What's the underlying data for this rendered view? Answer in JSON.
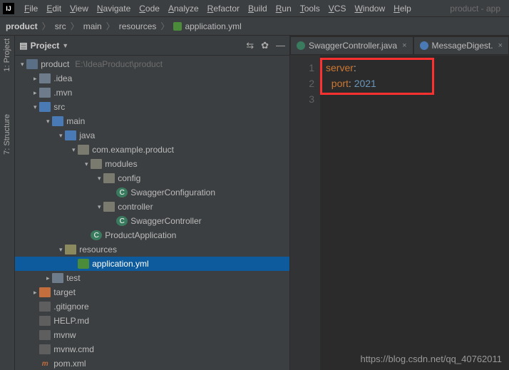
{
  "menu": {
    "items": [
      "File",
      "Edit",
      "View",
      "Navigate",
      "Code",
      "Analyze",
      "Refactor",
      "Build",
      "Run",
      "Tools",
      "VCS",
      "Window",
      "Help"
    ],
    "right": "product - app"
  },
  "breadcrumb": {
    "parts": [
      "product",
      "src",
      "main",
      "resources",
      "application.yml"
    ]
  },
  "gutter": {
    "project": "1: Project",
    "structure": "7: Structure"
  },
  "panel": {
    "title": "Project"
  },
  "tree": [
    {
      "d": 0,
      "c": "▾",
      "i": "module",
      "l": "product",
      "hint": "E:\\IdeaProduct\\product"
    },
    {
      "d": 1,
      "c": "▸",
      "i": "folder",
      "l": ".idea"
    },
    {
      "d": 1,
      "c": "▸",
      "i": "folder",
      "l": ".mvn"
    },
    {
      "d": 1,
      "c": "▾",
      "i": "java",
      "l": "src"
    },
    {
      "d": 2,
      "c": "▾",
      "i": "java",
      "l": "main"
    },
    {
      "d": 3,
      "c": "▾",
      "i": "java",
      "l": "java"
    },
    {
      "d": 4,
      "c": "▾",
      "i": "pkg",
      "l": "com.example.product"
    },
    {
      "d": 5,
      "c": "▾",
      "i": "pkg",
      "l": "modules"
    },
    {
      "d": 6,
      "c": "▾",
      "i": "pkg",
      "l": "config"
    },
    {
      "d": 7,
      "c": "",
      "i": "class",
      "l": "SwaggerConfiguration"
    },
    {
      "d": 6,
      "c": "▾",
      "i": "pkg",
      "l": "controller"
    },
    {
      "d": 7,
      "c": "",
      "i": "class",
      "l": "SwaggerController"
    },
    {
      "d": 5,
      "c": "",
      "i": "class",
      "l": "ProductApplication"
    },
    {
      "d": 3,
      "c": "▾",
      "i": "res",
      "l": "resources"
    },
    {
      "d": 4,
      "c": "",
      "i": "yml",
      "l": "application.yml",
      "sel": true
    },
    {
      "d": 2,
      "c": "▸",
      "i": "folder",
      "l": "test"
    },
    {
      "d": 1,
      "c": "▸",
      "i": "target",
      "l": "target"
    },
    {
      "d": 1,
      "c": "",
      "i": "file",
      "l": ".gitignore"
    },
    {
      "d": 1,
      "c": "",
      "i": "file",
      "l": "HELP.md"
    },
    {
      "d": 1,
      "c": "",
      "i": "file",
      "l": "mvnw"
    },
    {
      "d": 1,
      "c": "",
      "i": "file",
      "l": "mvnw.cmd"
    },
    {
      "d": 1,
      "c": "",
      "i": "m",
      "l": "pom.xml"
    }
  ],
  "tabs": [
    {
      "label": "SwaggerController.java",
      "icon": "#3a7a5e"
    },
    {
      "label": "MessageDigest.",
      "icon": "#4a7ab5"
    }
  ],
  "code": {
    "lines": [
      "1",
      "2",
      "3"
    ],
    "l1a": "server",
    "l1b": ":",
    "l2a": "port",
    "l2b": ": ",
    "l2c": "2021"
  },
  "watermark": "https://blog.csdn.net/qq_40762011"
}
